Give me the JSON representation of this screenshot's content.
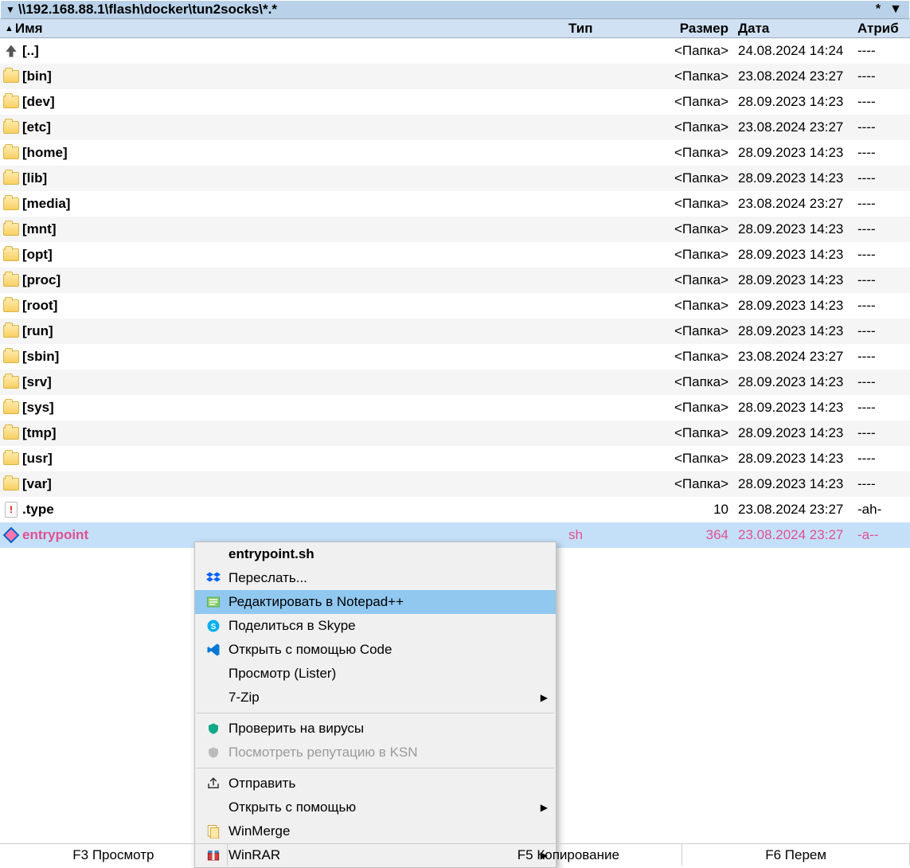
{
  "path_bar": {
    "path": "\\\\192.168.88.1\\flash\\docker\\tun2socks\\*.*",
    "star": "*",
    "drop": "▼"
  },
  "columns": {
    "name": "Имя",
    "type": "Тип",
    "size": "Размер",
    "date": "Дата",
    "attr": "Атриб"
  },
  "folder_size_label": "<Папка>",
  "rows": [
    {
      "icon": "up",
      "name": "[..]",
      "type": "",
      "size": "<Папка>",
      "date": "24.08.2024 14:24",
      "attr": "----"
    },
    {
      "icon": "folder",
      "name": "[bin]",
      "type": "",
      "size": "<Папка>",
      "date": "23.08.2024 23:27",
      "attr": "----"
    },
    {
      "icon": "folder",
      "name": "[dev]",
      "type": "",
      "size": "<Папка>",
      "date": "28.09.2023 14:23",
      "attr": "----"
    },
    {
      "icon": "folder",
      "name": "[etc]",
      "type": "",
      "size": "<Папка>",
      "date": "23.08.2024 23:27",
      "attr": "----"
    },
    {
      "icon": "folder",
      "name": "[home]",
      "type": "",
      "size": "<Папка>",
      "date": "28.09.2023 14:23",
      "attr": "----"
    },
    {
      "icon": "folder",
      "name": "[lib]",
      "type": "",
      "size": "<Папка>",
      "date": "28.09.2023 14:23",
      "attr": "----"
    },
    {
      "icon": "folder",
      "name": "[media]",
      "type": "",
      "size": "<Папка>",
      "date": "23.08.2024 23:27",
      "attr": "----"
    },
    {
      "icon": "folder",
      "name": "[mnt]",
      "type": "",
      "size": "<Папка>",
      "date": "28.09.2023 14:23",
      "attr": "----"
    },
    {
      "icon": "folder",
      "name": "[opt]",
      "type": "",
      "size": "<Папка>",
      "date": "28.09.2023 14:23",
      "attr": "----"
    },
    {
      "icon": "folder",
      "name": "[proc]",
      "type": "",
      "size": "<Папка>",
      "date": "28.09.2023 14:23",
      "attr": "----"
    },
    {
      "icon": "folder",
      "name": "[root]",
      "type": "",
      "size": "<Папка>",
      "date": "28.09.2023 14:23",
      "attr": "----"
    },
    {
      "icon": "folder",
      "name": "[run]",
      "type": "",
      "size": "<Папка>",
      "date": "28.09.2023 14:23",
      "attr": "----"
    },
    {
      "icon": "folder",
      "name": "[sbin]",
      "type": "",
      "size": "<Папка>",
      "date": "23.08.2024 23:27",
      "attr": "----"
    },
    {
      "icon": "folder",
      "name": "[srv]",
      "type": "",
      "size": "<Папка>",
      "date": "28.09.2023 14:23",
      "attr": "----"
    },
    {
      "icon": "folder",
      "name": "[sys]",
      "type": "",
      "size": "<Папка>",
      "date": "28.09.2023 14:23",
      "attr": "----"
    },
    {
      "icon": "folder",
      "name": "[tmp]",
      "type": "",
      "size": "<Папка>",
      "date": "28.09.2023 14:23",
      "attr": "----"
    },
    {
      "icon": "folder",
      "name": "[usr]",
      "type": "",
      "size": "<Папка>",
      "date": "28.09.2023 14:23",
      "attr": "----"
    },
    {
      "icon": "folder",
      "name": "[var]",
      "type": "",
      "size": "<Папка>",
      "date": "28.09.2023 14:23",
      "attr": "----"
    },
    {
      "icon": "excl",
      "name": ".type",
      "type": "",
      "size": "10",
      "date": "23.08.2024 23:27",
      "attr": "-ah-"
    },
    {
      "icon": "diamond",
      "name": "entrypoint",
      "type": "sh",
      "size": "364",
      "date": "23.08.2024 23:27",
      "attr": "-a--",
      "selected": true
    }
  ],
  "context_menu": [
    {
      "label": "entrypoint.sh",
      "bold": true,
      "icon": ""
    },
    {
      "label": "Переслать...",
      "icon": "dropbox"
    },
    {
      "label": "Редактировать в Notepad++",
      "icon": "notepadpp",
      "hover": true
    },
    {
      "label": "Поделиться в Skype",
      "icon": "skype"
    },
    {
      "label": "Открыть с помощью Code",
      "icon": "vscode"
    },
    {
      "label": "Просмотр (Lister)",
      "icon": ""
    },
    {
      "label": "7-Zip",
      "icon": "",
      "submenu": true
    },
    {
      "sep": true
    },
    {
      "label": "Проверить на вирусы",
      "icon": "shield-green"
    },
    {
      "label": "Посмотреть репутацию в KSN",
      "icon": "shield-grey",
      "disabled": true
    },
    {
      "sep": true
    },
    {
      "label": "Отправить",
      "icon": "share"
    },
    {
      "label": "Открыть с помощью",
      "icon": "",
      "submenu": true
    },
    {
      "label": "WinMerge",
      "icon": "winmerge"
    },
    {
      "label": "WinRAR",
      "icon": "winrar",
      "submenu": true
    }
  ],
  "bottom_bar": {
    "f3": "F3 Просмотр",
    "f5": "F5 Копирование",
    "f6": "F6 Перем"
  }
}
